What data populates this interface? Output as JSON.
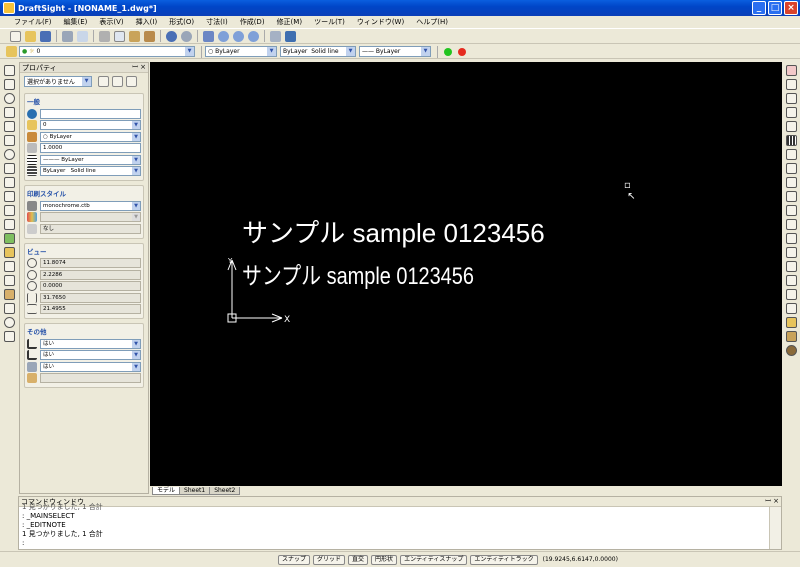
{
  "window": {
    "title": "DraftSight - [NONAME_1.dwg*]"
  },
  "menu": [
    "ファイル(F)",
    "編集(E)",
    "表示(V)",
    "挿入(I)",
    "形式(O)",
    "寸法(I)",
    "作成(D)",
    "修正(M)",
    "ツール(T)",
    "ウィンドウ(W)",
    "ヘルプ(H)"
  ],
  "layer_toolbar": {
    "layer": "0",
    "color": "ByLayer",
    "linetype": "ByLayer",
    "linestyle": "Solid line",
    "lineweight": "ByLayer"
  },
  "properties": {
    "title": "プロパティ",
    "selection": "選択がありません",
    "general": {
      "title": "一般",
      "color": "",
      "layer": "0",
      "color2": "ByLayer",
      "scale": "1.0000",
      "linetype": "ByLayer",
      "linestyle_a": "ByLayer",
      "linestyle_b": "Solid line"
    },
    "print": {
      "title": "印刷スタイル",
      "table": "monochrome.ctb",
      "style": "",
      "none": "なし"
    },
    "view": {
      "title": "ビュー",
      "values": [
        "11.8074",
        "2.2286",
        "0.0000",
        "31.7650",
        "21.4955"
      ]
    },
    "other": {
      "title": "その他",
      "values": [
        "はい",
        "はい",
        "はい",
        ""
      ]
    }
  },
  "canvas": {
    "text1": "サンプル sample 0123456",
    "text2": "サンプル sample 0123456",
    "ucs_y": "Y",
    "ucs_x": "X"
  },
  "sheets": [
    "モデル",
    "Sheet1",
    "Sheet2"
  ],
  "command": {
    "title": "コマンドウィンドウ",
    "lines": [
      "1 見つかりました, 1 合計",
      ": _MAINSELECT",
      ": _EDITNOTE",
      "1 見つかりました, 1 合計",
      ":"
    ]
  },
  "status": {
    "buttons": [
      "スナップ",
      "グリッド",
      "直交",
      "円形状",
      "エンティティスナップ",
      "エンティティトラック"
    ],
    "coords": "(19.9245,6.6147,0.0000)"
  }
}
